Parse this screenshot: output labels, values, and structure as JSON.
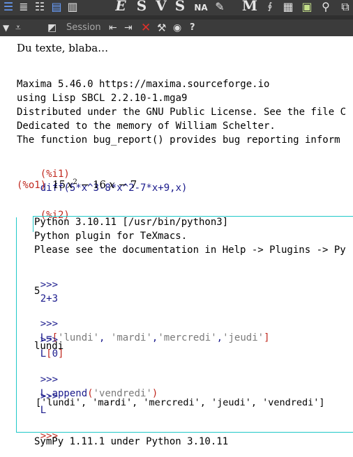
{
  "toolbar1": {
    "letters": [
      "E",
      "S",
      "V",
      "S"
    ],
    "na_label": "NA"
  },
  "toolbar2": {
    "session_label": "Session",
    "help_label": "?"
  },
  "document": {
    "intro_text": "Du texte, blaba…",
    "maxima_banner": [
      "Maxima 5.46.0 https://maxima.sourceforge.io",
      "using Lisp SBCL 2.2.10-1.mga9",
      "Distributed under the GNU Public License. See the file C",
      "Dedicated to the memory of William Schelter.",
      "The function bug_report() provides bug reporting inform"
    ],
    "maxima": {
      "i1_prompt": "(%i1)",
      "i1_input": "diff(5*x^3-8*x^2-7*x+9,x)",
      "o1_prompt": "(%o1)",
      "o1_coef1": "15",
      "o1_var1": "x",
      "o1_exp": "2",
      "o1_rest": " − 16",
      "o1_var2": "x",
      "o1_tail": " − 7",
      "i2_prompt": "(%i2)"
    },
    "python_banner": [
      "Python 3.10.11 [/usr/bin/python3]",
      "Python plugin for TeXmacs.",
      "Please see the documentation in Help -> Plugins -> Py"
    ],
    "python": {
      "prompt": ">>>",
      "in1": "2+3",
      "out1": "5",
      "in2_a": "L=",
      "in2_b": "[",
      "in2_s1": "'lundi'",
      "in2_c1": ", ",
      "in2_s2": "'mardi'",
      "in2_c2": ",",
      "in2_s3": "'mercredi'",
      "in2_c3": ",",
      "in2_s4": "'jeudi'",
      "in2_e": "]",
      "in3_a": "L",
      "in3_b": "[",
      "in3_n": "0",
      "in3_e": "]",
      "out3": "lundi",
      "in4_a": "L.append",
      "in4_b": "(",
      "in4_s": "'vendredi'",
      "in4_e": ")",
      "in5": "L",
      "out5": "['lundi', 'mardi', 'mercredi', 'jeudi', 'vendredi']"
    },
    "sympy_line": "SymPy 1.11.1 under Python 3.10.11"
  }
}
